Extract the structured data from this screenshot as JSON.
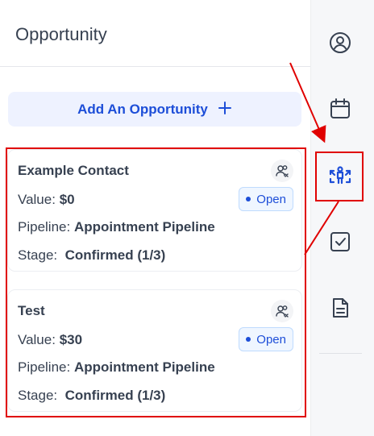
{
  "panel": {
    "title": "Opportunity",
    "add_button_label": "Add An Opportunity",
    "add_button_icon": "plus-icon"
  },
  "opportunities": [
    {
      "name": "Example Contact",
      "status": "Open",
      "value_label": "Value:",
      "value": "$0",
      "pipeline_label": "Pipeline:",
      "pipeline": "Appointment Pipeline",
      "stage_label": "Stage:",
      "stage": "Confirmed (1/3)"
    },
    {
      "name": "Test",
      "status": "Open",
      "value_label": "Value:",
      "value": "$30",
      "pipeline_label": "Pipeline:",
      "pipeline": "Appointment Pipeline",
      "stage_label": "Stage:",
      "stage": "Confirmed (1/3)"
    }
  ],
  "rail": {
    "icons": [
      "contact-icon",
      "calendar-icon",
      "opportunity-icon",
      "task-icon",
      "notes-icon"
    ],
    "active": "opportunity-icon"
  },
  "colors": {
    "accent": "#1d4ed8",
    "highlight": "#e00000",
    "rail_background": "#f6f7f9"
  }
}
